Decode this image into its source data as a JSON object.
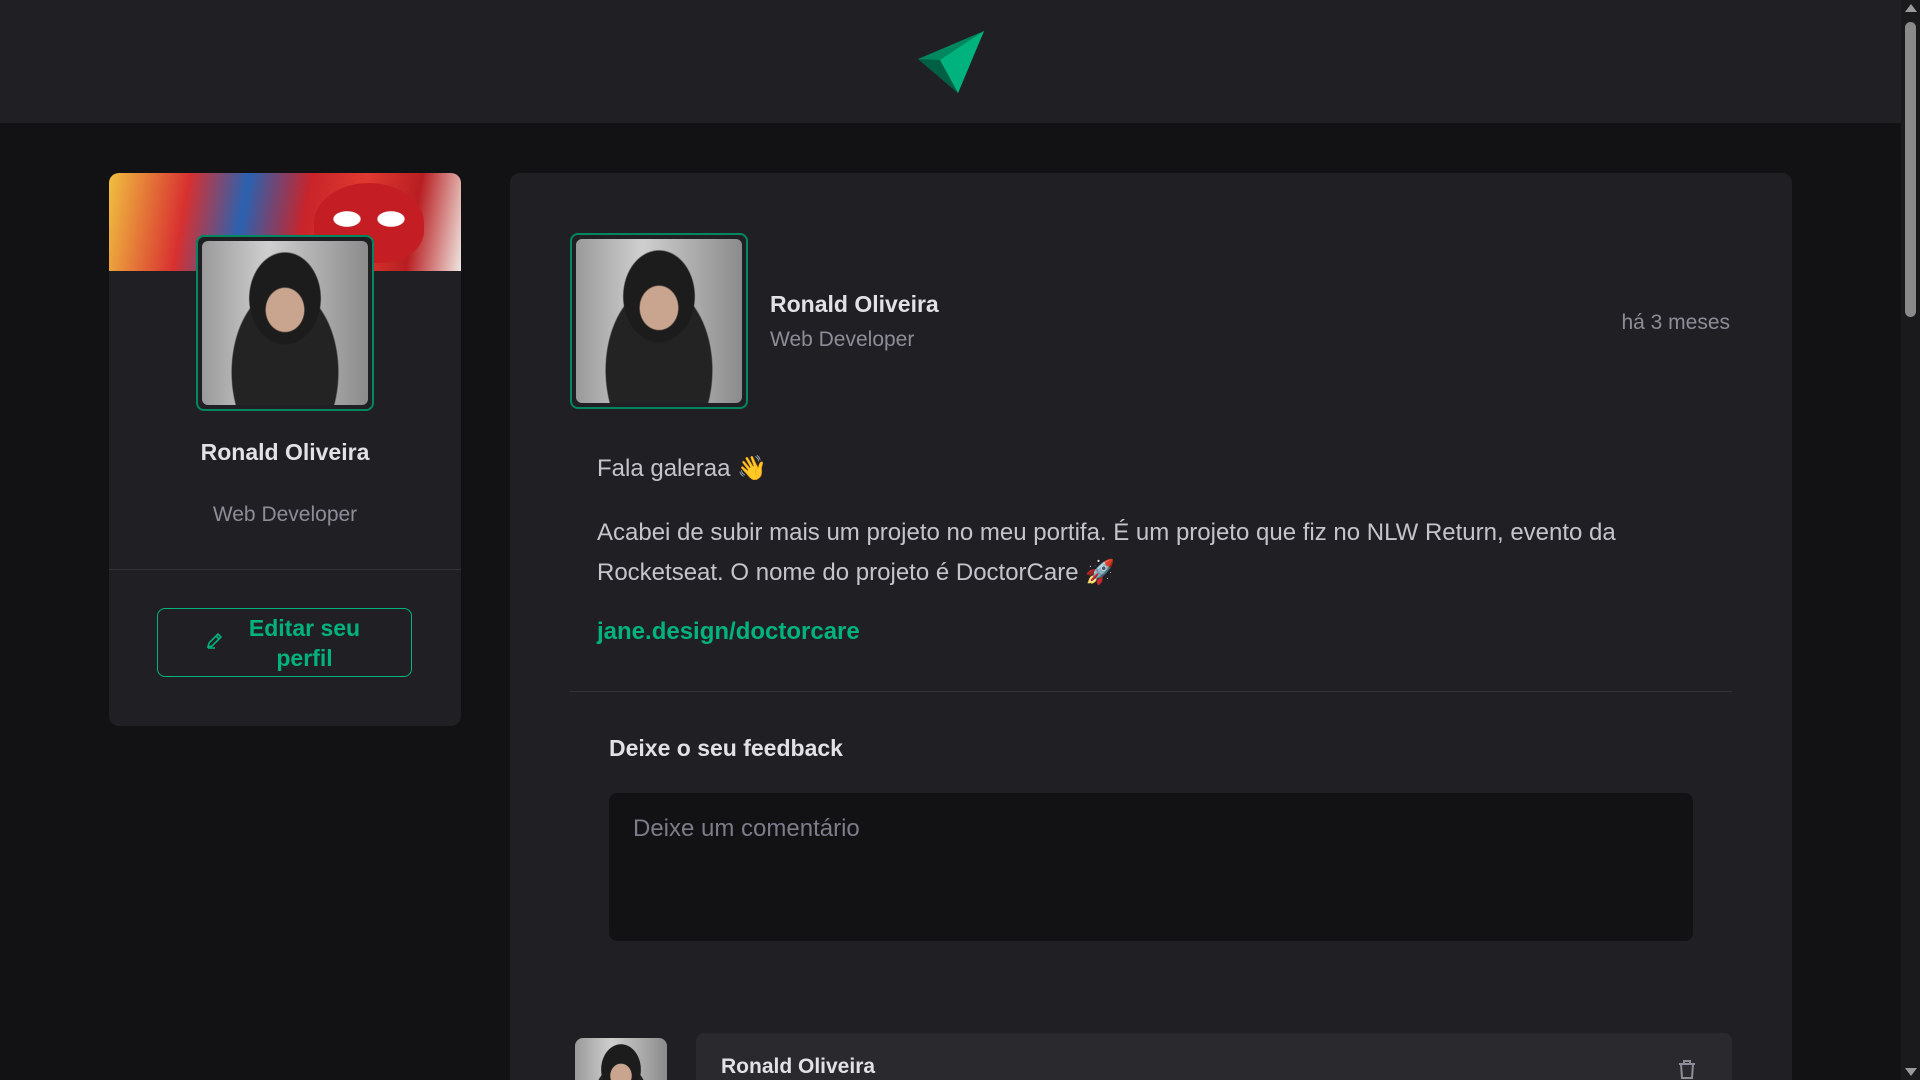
{
  "header": {
    "logo_icon": "paper-plane-logo-icon"
  },
  "sidebar": {
    "name": "Ronald Oliveira",
    "role": "Web Developer",
    "edit_button_label": "Editar seu perfil",
    "edit_icon": "pencil-icon"
  },
  "post": {
    "author_name": "Ronald Oliveira",
    "author_role": "Web Developer",
    "time": "há 3 meses",
    "greeting": "Fala galeraa 👋",
    "body": "Acabei de subir mais um projeto no meu portifa. É um projeto que fiz no NLW Return, evento da Rocketseat. O nome do projeto é DoctorCare 🚀",
    "link": "jane.design/doctorcare"
  },
  "feedback": {
    "title": "Deixe o seu feedback",
    "placeholder": "Deixe um comentário"
  },
  "comments": [
    {
      "author": "Ronald Oliveira",
      "delete_icon": "trash-icon"
    }
  ],
  "colors": {
    "accent": "#00B37E",
    "background": "#121214",
    "card": "#202024",
    "muted_text": "#8D8D99"
  }
}
